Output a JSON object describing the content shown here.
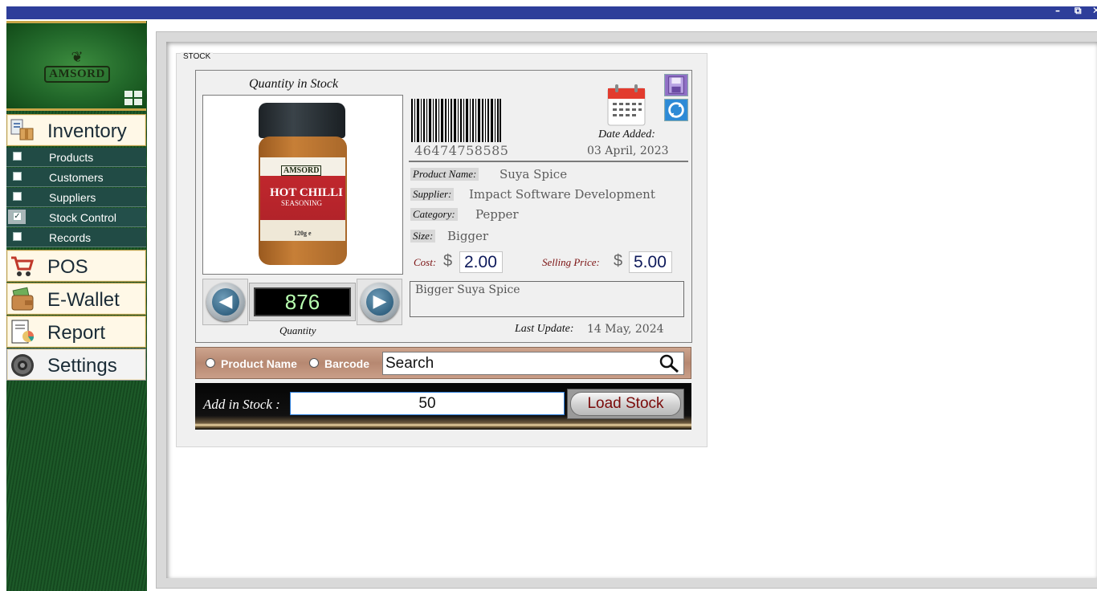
{
  "window": {
    "minimize": "–",
    "restore": "⧉",
    "close": "✕"
  },
  "sidebar": {
    "brand": "AMSORD",
    "main": [
      {
        "label": "Inventory",
        "icon": "inventory-icon"
      },
      {
        "label": "POS",
        "icon": "cart-icon"
      },
      {
        "label": "E-Wallet",
        "icon": "wallet-icon"
      },
      {
        "label": "Report",
        "icon": "report-icon"
      },
      {
        "label": "Settings",
        "icon": "settings-icon"
      }
    ],
    "inventory_items": [
      {
        "label": "Products",
        "checked": false
      },
      {
        "label": "Customers",
        "checked": false
      },
      {
        "label": "Suppliers",
        "checked": false
      },
      {
        "label": "Stock Control",
        "checked": true
      },
      {
        "label": "Records",
        "checked": false
      }
    ]
  },
  "stock": {
    "group_title": "STOCK",
    "qty_title": "Quantity in Stock",
    "quantity": "876",
    "quantity_label": "Quantity",
    "product_image": {
      "brand": "AMSORD",
      "name": "HOT CHILLI",
      "sub": "SEASONING",
      "weight": "120g e"
    },
    "barcode": "46474758585",
    "date_added_label": "Date Added:",
    "date_added": "03 April, 2023",
    "fields": {
      "product_name_label": "Product Name:",
      "product_name": "Suya Spice",
      "supplier_label": "Supplier:",
      "supplier": "Impact Software Development",
      "category_label": "Category:",
      "category": "Pepper",
      "size_label": "Size:",
      "size": "Bigger"
    },
    "cost_label": "Cost:",
    "cost": "2.00",
    "selling_label": "Selling Price:",
    "selling": "5.00",
    "currency": "$",
    "description": "Bigger Suya Spice",
    "last_update_label": "Last Update:",
    "last_update": "14 May, 2024"
  },
  "search": {
    "option_name": "Product Name",
    "option_barcode": "Barcode",
    "value": "Search"
  },
  "add_stock": {
    "label": "Add in Stock :",
    "value": "50",
    "button": "Load Stock"
  },
  "colors": {
    "title_bar": "#2e3e9a",
    "accent_red": "#7a0a0a",
    "sidebar_sub": "#214b45"
  }
}
